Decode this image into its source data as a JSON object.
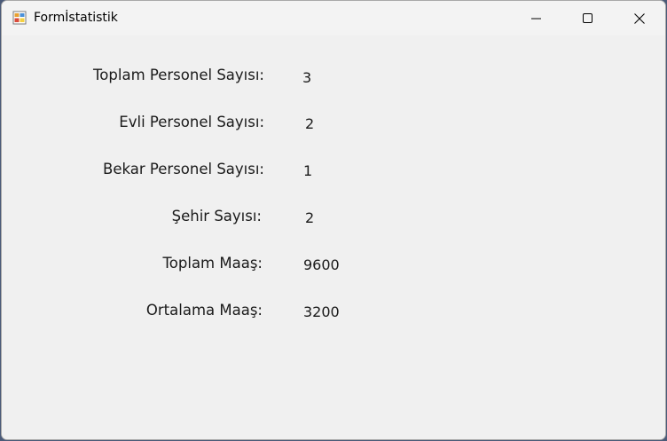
{
  "window": {
    "title": "Formİstatistik",
    "icons": {
      "app": "winforms-app-icon",
      "minimize": "minimize-icon",
      "maximize": "maximize-icon",
      "close": "close-icon"
    }
  },
  "stats": [
    {
      "label": "Toplam Personel Sayısı:",
      "value": "3"
    },
    {
      "label": "Evli Personel Sayısı:",
      "value": "2"
    },
    {
      "label": "Bekar Personel Sayısı:",
      "value": "1"
    },
    {
      "label": "Şehir Sayısı:",
      "value": "2"
    },
    {
      "label": "Toplam Maaş:",
      "value": "9600"
    },
    {
      "label": "Ortalama Maaş:",
      "value": "3200"
    }
  ]
}
